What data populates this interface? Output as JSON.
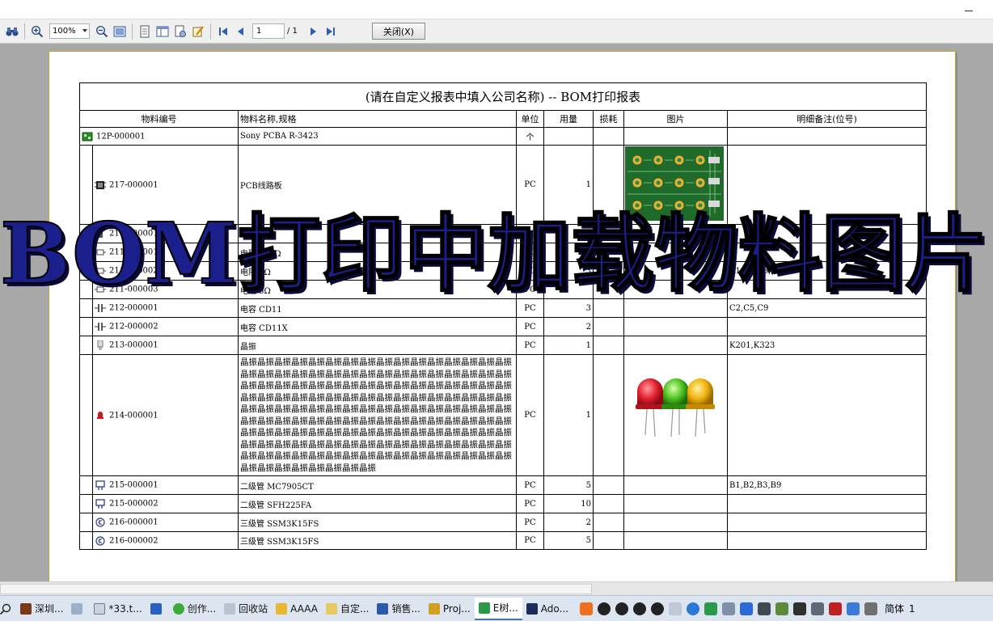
{
  "toolbar": {
    "zoom_value": "100%",
    "page_current": "1",
    "page_total": "/ 1",
    "close_label": "关闭(X)"
  },
  "report": {
    "title": "(请在自定义报表中填入公司名称)  -- BOM打印报表",
    "headers": [
      "物料编号",
      "物料名称,规格",
      "单位",
      "用量",
      "损耗",
      "图片",
      "明细备注(位号)"
    ],
    "rows": [
      {
        "code": "12P-000001",
        "name": "Sony PCBA R-3423",
        "unit": "个",
        "qty": "",
        "loss": "",
        "remark": ""
      },
      {
        "code": "217-000001",
        "name": "PCB线路板",
        "unit": "PC",
        "qty": "1",
        "loss": "",
        "remark": ""
      },
      {
        "code": "210-000001",
        "name": "IC",
        "unit": "PC",
        "qty": "",
        "loss": "",
        "remark": ""
      },
      {
        "code": "211-000001",
        "name": "电阻 100Ω",
        "unit": "PC",
        "qty": "5",
        "loss": "",
        "remark": ""
      },
      {
        "code": "211-000002",
        "name": "电阻 1Ω",
        "unit": "PC",
        "qty": "3",
        "loss": "",
        "remark": "R1,R2,R3,R4"
      },
      {
        "code": "211-000003",
        "name": "电阻 5Ω",
        "unit": "PC",
        "qty": "",
        "loss": "",
        "remark": ""
      },
      {
        "code": "212-000001",
        "name": "电容 CD11",
        "unit": "PC",
        "qty": "3",
        "loss": "",
        "remark": "C2,C5,C9"
      },
      {
        "code": "212-000002",
        "name": "电容 CD11X",
        "unit": "PC",
        "qty": "2",
        "loss": "",
        "remark": ""
      },
      {
        "code": "213-000001",
        "name": "晶振",
        "unit": "PC",
        "qty": "1",
        "loss": "",
        "remark": "K201,K323"
      },
      {
        "code": "214-000001",
        "name": "晶振晶振晶振晶振晶振晶振晶振晶振晶振晶振晶振晶振晶振晶振晶振晶振晶振晶振晶振晶振晶振晶振晶振晶振晶振晶振晶振晶振晶振晶振晶振晶振晶振晶振晶振晶振晶振晶振晶振晶振晶振晶振晶振晶振晶振晶振晶振晶振晶振晶振晶振晶振晶振晶振晶振晶振晶振晶振晶振晶振晶振晶振晶振晶振晶振晶振晶振晶振晶振晶振晶振晶振晶振晶振晶振晶振晶振晶振晶振晶振晶振晶振晶振晶振晶振晶振晶振晶振晶振晶振晶振晶振晶振晶振晶振晶振晶振晶振晶振晶振晶振晶振晶振晶振晶振晶振晶振晶振晶振晶振晶振晶振晶振晶振晶振晶振晶振晶振晶振晶振晶振晶振晶振晶振晶振晶振晶振晶振晶振晶振晶振晶振晶振晶振晶振晶振晶振晶振晶振晶振晶振晶振晶振晶振晶振晶振晶振晶振晶振晶振晶振晶振",
        "unit": "PC",
        "qty": "1",
        "loss": "",
        "remark": ""
      },
      {
        "code": "215-000001",
        "name": "二级管 MC7905CT",
        "unit": "PC",
        "qty": "5",
        "loss": "",
        "remark": "B1,B2,B3,B9"
      },
      {
        "code": "215-000002",
        "name": "二级管 SFH225FA",
        "unit": "PC",
        "qty": "10",
        "loss": "",
        "remark": ""
      },
      {
        "code": "216-000001",
        "name": "三级管 SSM3K15FS",
        "unit": "PC",
        "qty": "2",
        "loss": "",
        "remark": ""
      },
      {
        "code": "216-000002",
        "name": "三级管 SSM3K15FS",
        "unit": "PC",
        "qty": "5",
        "loss": "",
        "remark": ""
      }
    ]
  },
  "overlay": {
    "caption": "BOM打印中加载物料图片",
    "color": "#1a1f8c"
  },
  "taskbar": {
    "items": [
      "深圳...",
      "*33.t...",
      "创作...",
      "回收站",
      "AAAA",
      "自定...",
      "销售...",
      "Proj...",
      "E树...",
      "Ado..."
    ],
    "lang": "简体",
    "clock": "1"
  },
  "icons": {
    "find": "binoculars-icon",
    "zoom_in": "zoom-in-icon",
    "zoom_out": "zoom-out-icon",
    "first": "first-page-icon",
    "prev": "prev-page-icon",
    "next": "next-page-icon",
    "last": "last-page-icon"
  }
}
